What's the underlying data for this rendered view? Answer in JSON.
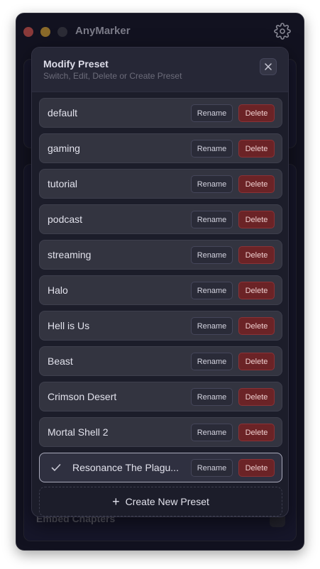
{
  "window": {
    "title": "AnyMarker"
  },
  "background": {
    "footer_label": "Embed Chapters"
  },
  "modal": {
    "title": "Modify Preset",
    "subtitle": "Switch, Edit, Delete or Create Preset",
    "rename_label": "Rename",
    "delete_label": "Delete",
    "create_label": "Create New Preset",
    "presets": [
      {
        "name": "default",
        "selected": false
      },
      {
        "name": "gaming",
        "selected": false
      },
      {
        "name": "tutorial",
        "selected": false
      },
      {
        "name": "podcast",
        "selected": false
      },
      {
        "name": "streaming",
        "selected": false
      },
      {
        "name": "Halo",
        "selected": false
      },
      {
        "name": "Hell is Us",
        "selected": false
      },
      {
        "name": "Beast",
        "selected": false
      },
      {
        "name": "Crimson Desert",
        "selected": false
      },
      {
        "name": "Mortal Shell 2",
        "selected": false
      },
      {
        "name": "Resonance The Plagu...",
        "selected": true
      }
    ]
  },
  "colors": {
    "delete_accent": "#6b2326",
    "window_bg": "#121220",
    "modal_bg": "#1c1d2a"
  },
  "icons": {
    "settings": "gear-icon",
    "close": "close-icon",
    "check": "check-icon",
    "plus": "plus-icon"
  }
}
